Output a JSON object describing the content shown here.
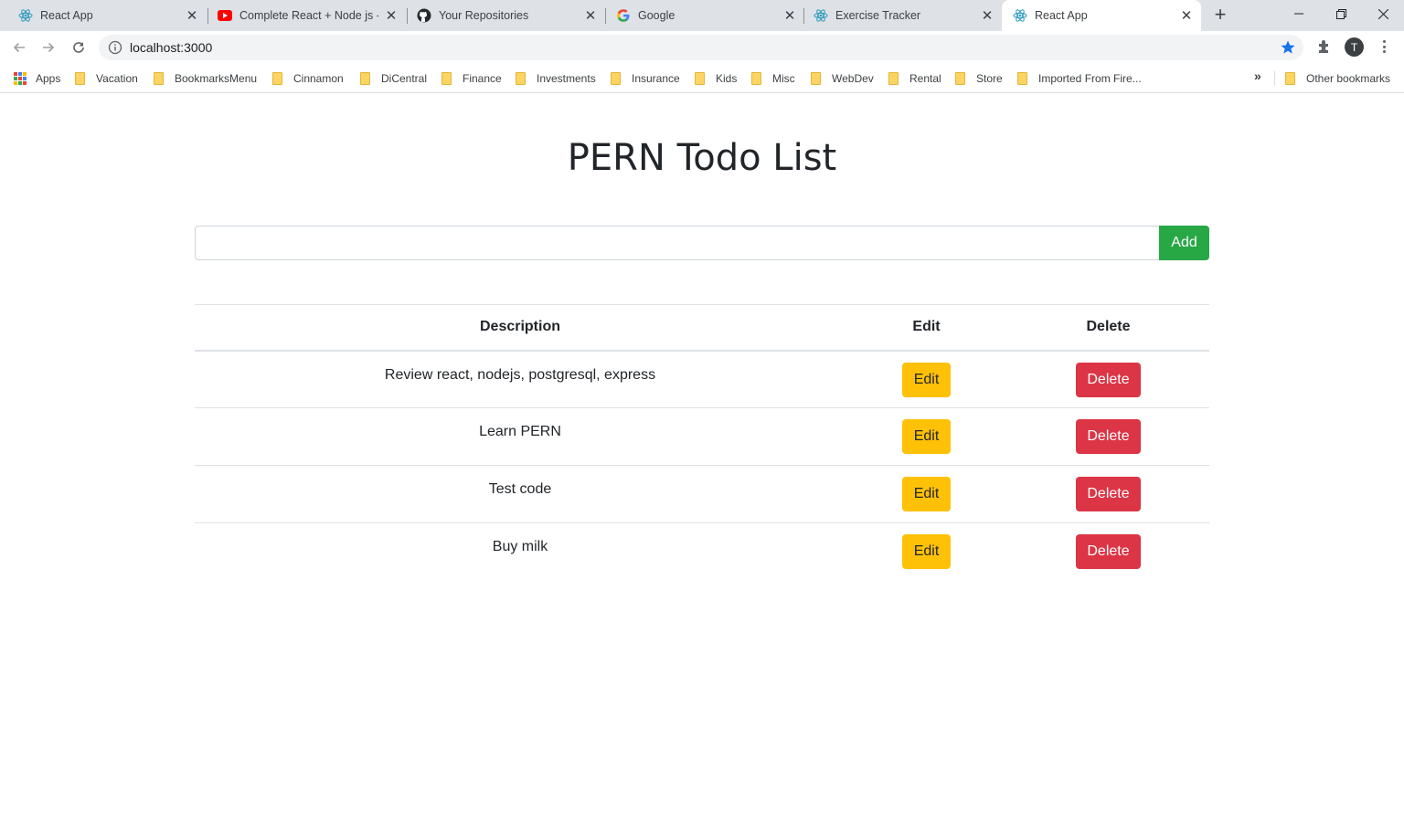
{
  "browser": {
    "tabs": [
      {
        "title": "React App",
        "icon": "react-icon",
        "active": false
      },
      {
        "title": "Complete React + Node js - C",
        "icon": "youtube-icon",
        "active": false
      },
      {
        "title": "Your Repositories",
        "icon": "github-icon",
        "active": false
      },
      {
        "title": "Google",
        "icon": "google-icon",
        "active": false
      },
      {
        "title": "Exercise Tracker",
        "icon": "react-icon",
        "active": false
      },
      {
        "title": "React App",
        "icon": "react-icon",
        "active": true
      }
    ],
    "url": "localhost:3000",
    "profile_initial": "T",
    "bookmarks": [
      {
        "label": "Apps"
      },
      {
        "label": "Vacation"
      },
      {
        "label": "BookmarksMenu"
      },
      {
        "label": "Cinnamon"
      },
      {
        "label": "DiCentral"
      },
      {
        "label": "Finance"
      },
      {
        "label": "Investments"
      },
      {
        "label": "Insurance"
      },
      {
        "label": "Kids"
      },
      {
        "label": "Misc"
      },
      {
        "label": "WebDev"
      },
      {
        "label": "Rental"
      },
      {
        "label": "Store"
      },
      {
        "label": "Imported From Fire..."
      }
    ],
    "overflow_chevron": "»",
    "other_bookmarks": "Other bookmarks"
  },
  "app": {
    "title": "PERN Todo List",
    "input_value": "",
    "add_label": "Add",
    "table": {
      "headers": {
        "description": "Description",
        "edit": "Edit",
        "delete": "Delete"
      },
      "rows": [
        {
          "description": "Review react, nodejs, postgresql, express",
          "edit": "Edit",
          "delete": "Delete"
        },
        {
          "description": "Learn PERN",
          "edit": "Edit",
          "delete": "Delete"
        },
        {
          "description": "Test code",
          "edit": "Edit",
          "delete": "Delete"
        },
        {
          "description": "Buy milk",
          "edit": "Edit",
          "delete": "Delete"
        }
      ]
    }
  },
  "colors": {
    "add_button": "#28a745",
    "edit_button": "#ffc107",
    "delete_button": "#dc3545",
    "text": "#212529"
  }
}
